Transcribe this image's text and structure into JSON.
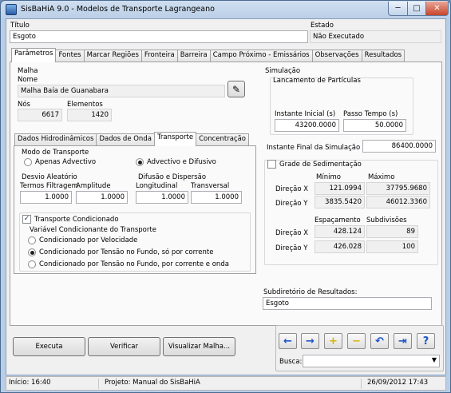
{
  "window": {
    "title": "SisBaHiA 9.0 - Modelos de Transporte Lagrangeano",
    "min_glyph": "─",
    "max_glyph": "□",
    "close_glyph": "✕"
  },
  "header": {
    "titulo_label": "Título",
    "titulo_value": "Esgoto",
    "estado_label": "Estado",
    "estado_value": "Não Executado"
  },
  "main_tabs": [
    "Parâmetros",
    "Fontes",
    "Marcar Regiões",
    "Fronteira",
    "Barreira",
    "Campo Próximo - Emissários",
    "Observações",
    "Resultados"
  ],
  "malha": {
    "group_label": "Malha",
    "nome_label": "Nome",
    "nome_value": "Malha Baía de Guanabara",
    "nos_label": "Nós",
    "nos_value": "6617",
    "elementos_label": "Elementos",
    "elementos_value": "1420"
  },
  "sub_tabs": [
    "Dados Hidrodinâmicos",
    "Dados de Onda",
    "Transporte",
    "Concentração"
  ],
  "transporte": {
    "modo_label": "Modo de Transporte",
    "opt_advectivo": "Apenas Advectivo",
    "opt_difusivo": "Advectivo e Difusivo",
    "desvio_label": "Desvio Aleatório",
    "termos_label": "Termos Filtragem",
    "termos_value": "1.0000",
    "amplitude_label": "Amplitude",
    "amplitude_value": "1.0000",
    "difusao_label": "Difusão e Dispersão",
    "longitudinal_label": "Longitudinal",
    "longitudinal_value": "1.0000",
    "transversal_label": "Transversal",
    "transversal_value": "1.0000",
    "condicionado_label": "Transporte Condicionado",
    "variavel_label": "Variável Condicionante do Transporte",
    "cond_options": [
      "Condicionado por Velocidade",
      "Condicionado por Tensão no Fundo, só por corrente",
      "Condicionado por Tensão no Fundo, por corrente e onda"
    ]
  },
  "simulacao": {
    "group_label": "Simulação",
    "lancamento_label": "Lancamento de Partículas",
    "instante_inicial_label": "Instante Inicial (s)",
    "instante_inicial_value": "43200.0000",
    "passo_tempo_label": "Passo Tempo (s)",
    "passo_tempo_value": "50.0000",
    "instante_final_label": "Instante Final da Simulação (s):",
    "instante_final_value": "86400.0000"
  },
  "grade": {
    "checkbox_label": "Grade de Sedimentação",
    "minimo_label": "Mínimo",
    "maximo_label": "Máximo",
    "direcao_x_label": "Direção X",
    "direcao_y_label": "Direção Y",
    "min_x": "121.0994",
    "max_x": "37795.9680",
    "min_y": "3835.5420",
    "max_y": "46012.3360",
    "espacamento_label": "Espaçamento",
    "subdivisoes_label": "Subdivisões",
    "esp_x": "428.124",
    "sub_x": "89",
    "esp_y": "426.028",
    "sub_y": "100"
  },
  "subdiretorio": {
    "label": "Subdiretório de Resultados:",
    "value": "Esgoto"
  },
  "buttons": {
    "executa": "Executa",
    "verificar": "Verificar",
    "visualizar": "Visualizar Malha..."
  },
  "nav": {
    "busca_label": "Busca:",
    "busca_value": "",
    "prev_glyph": "←",
    "next_glyph": "→",
    "add_glyph": "+",
    "remove_glyph": "−",
    "undo_glyph": "↶",
    "exit_glyph": "⇥",
    "help_glyph": "?"
  },
  "status": {
    "inicio": "Início: 16:40",
    "projeto": "Projeto: Manual do SisBaHiA",
    "datetime": "26/09/2012 17:43"
  },
  "colors": {
    "nav_blue": "#1d55c8",
    "nav_yellow": "#d7b400",
    "window_frame": "#b9cde6"
  }
}
